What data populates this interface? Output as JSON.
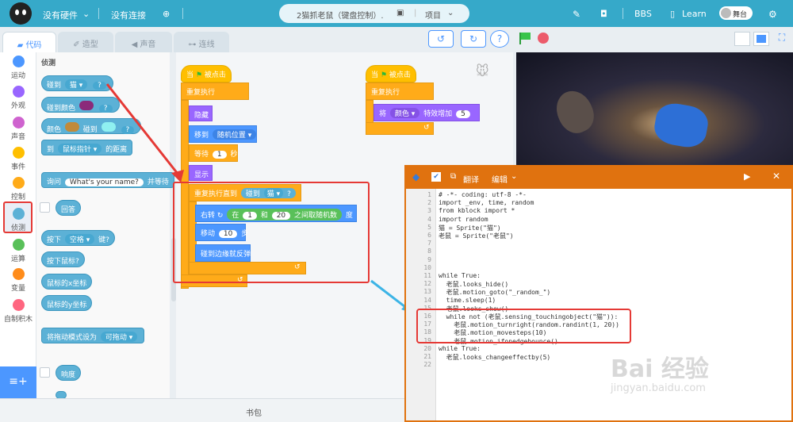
{
  "topbar": {
    "hardware": "没有硬件",
    "connection": "没有连接",
    "project_name": "2猫抓老鼠（键盘控制）.",
    "project_menu": "项目",
    "bbs": "BBS",
    "learn": "Learn",
    "stage_toggle": "舞台"
  },
  "tabs": [
    "代码",
    "造型",
    "声音",
    "连线"
  ],
  "categories": [
    {
      "label": "运动",
      "color": "#4c97ff"
    },
    {
      "label": "外观",
      "color": "#9966ff"
    },
    {
      "label": "声音",
      "color": "#cf63cf"
    },
    {
      "label": "事件",
      "color": "#ffbf00"
    },
    {
      "label": "控制",
      "color": "#ffab19"
    },
    {
      "label": "侦测",
      "color": "#5cb1d6"
    },
    {
      "label": "运算",
      "color": "#59c059"
    },
    {
      "label": "变量",
      "color": "#ff8c1a"
    },
    {
      "label": "自制积木",
      "color": "#ff6680"
    }
  ],
  "palette": {
    "section": "侦测",
    "touching": "碰到",
    "touching_target": "猫",
    "q": "?",
    "touching_color": "碰到颜色",
    "color_word": "颜色",
    "touch_word": "碰到",
    "to": "到",
    "mouse_pointer": "鼠标指针",
    "distance": "的距离",
    "ask": "询问",
    "ask_default": "What's your name?",
    "and_wait": "并等待",
    "answer": "回答",
    "key_pressed_1": "按下",
    "key_space": "空格",
    "key_pressed_2": "键?",
    "mouse_down": "按下鼠标?",
    "mouse_x": "鼠标的x坐标",
    "mouse_y": "鼠标的y坐标",
    "drag_mode": "将拖动模式设为",
    "drag_value": "可拖动",
    "loudness": "响度"
  },
  "script1": {
    "when_flag": "当",
    "clicked": "被点击",
    "forever": "重复执行",
    "hide": "隐藏",
    "goto": "移到",
    "random_pos": "随机位置",
    "wait": "等待",
    "wait_val": "1",
    "seconds": "秒",
    "show": "显示",
    "repeat_until": "重复执行直到",
    "touching": "碰到",
    "cat": "猫",
    "q": "?",
    "turn_right": "右转",
    "pick_from": "在",
    "from": "1",
    "and": "和",
    "to": "20",
    "random_between": "之间取随机数",
    "degrees": "度",
    "move": "移动",
    "move_val": "10",
    "steps": "步",
    "bounce": "碰到边缘就反弹"
  },
  "script2": {
    "when_flag": "当",
    "clicked": "被点击",
    "forever": "重复执行",
    "change": "将",
    "effect": "颜色",
    "effect_by": "特效增加",
    "value": "5"
  },
  "codewin": {
    "translate": "翻译",
    "edit": "编辑",
    "lines": [
      {
        "n": "1",
        "t": "# -*- coding: utf-8 -*-"
      },
      {
        "n": "2",
        "t": "import _env, time, random"
      },
      {
        "n": "3",
        "t": "from kblock import *"
      },
      {
        "n": "4",
        "t": "import random"
      },
      {
        "n": "5",
        "t": "猫 = Sprite(\"猫\")"
      },
      {
        "n": "6",
        "t": "老鼠 = Sprite(\"老鼠\")"
      },
      {
        "n": "7",
        "t": ""
      },
      {
        "n": "8",
        "t": ""
      },
      {
        "n": "9",
        "t": ""
      },
      {
        "n": "10",
        "t": ""
      },
      {
        "n": "11",
        "t": "while True:"
      },
      {
        "n": "12",
        "t": "  老鼠.looks_hide()"
      },
      {
        "n": "13",
        "t": "  老鼠.motion_goto(\"_random_\")"
      },
      {
        "n": "14",
        "t": "  time.sleep(1)"
      },
      {
        "n": "15",
        "t": "  老鼠.looks_show()"
      },
      {
        "n": "16",
        "t": "  while not (老鼠.sensing_touchingobject(\"猫\")):"
      },
      {
        "n": "17",
        "t": "    老鼠.motion_turnright(random.randint(1, 20))"
      },
      {
        "n": "18",
        "t": "    老鼠.motion_movesteps(10)"
      },
      {
        "n": "19",
        "t": "    老鼠.motion_ifonedgebounce()"
      },
      {
        "n": "20",
        "t": "while True:"
      },
      {
        "n": "21",
        "t": "  老鼠.looks_changeeffectby(5)"
      },
      {
        "n": "22",
        "t": ""
      }
    ]
  },
  "footer": {
    "backpack": "书包"
  },
  "watermark": {
    "brand": "Bai 经验",
    "url": "jingyan.baidu.com"
  }
}
